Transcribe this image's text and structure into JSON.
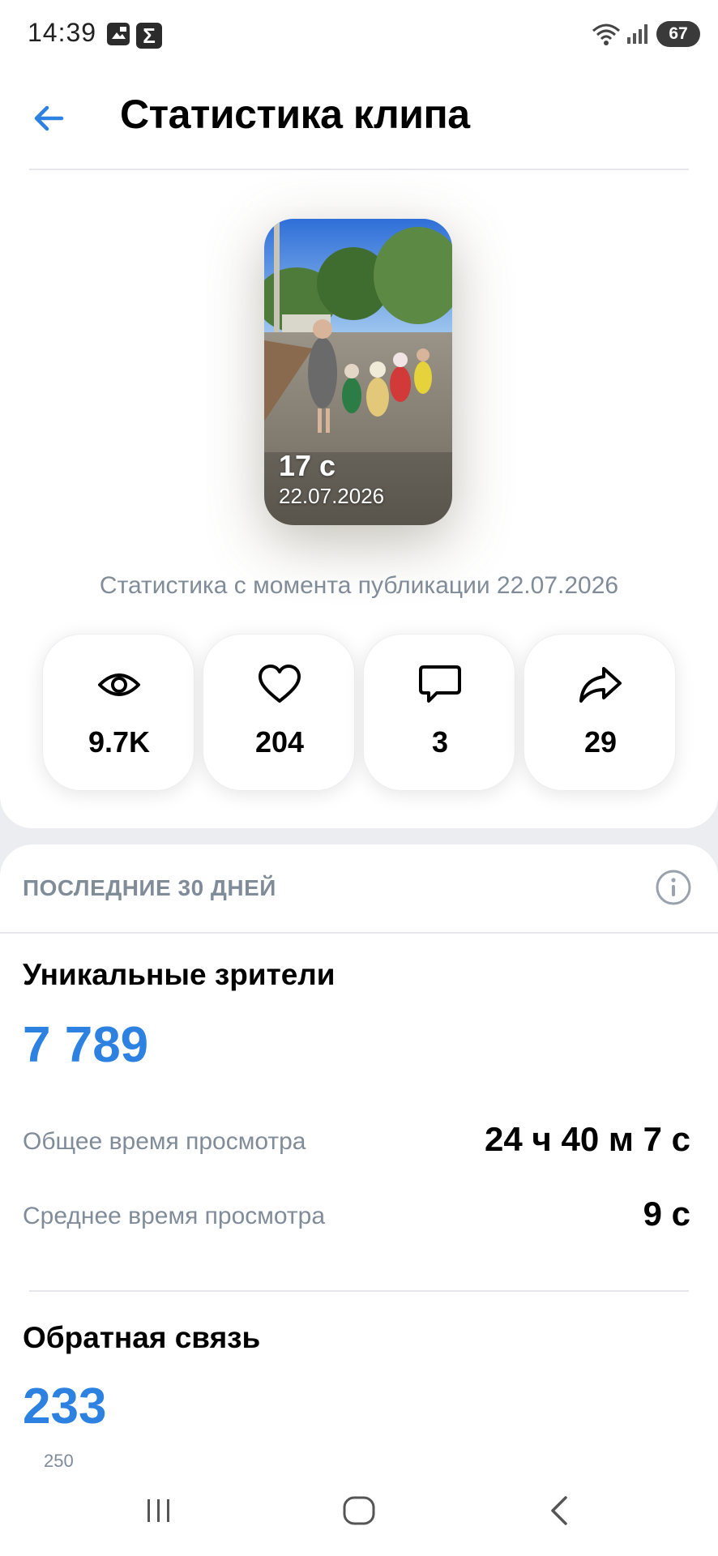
{
  "status_bar": {
    "time": "14:39",
    "notification_icons": [
      "media-icon",
      "sigma-app-icon"
    ],
    "sigma_glyph": "Σ",
    "battery": "67"
  },
  "header": {
    "title": "Статистика клипа",
    "back_icon": "arrow-left-icon"
  },
  "clip": {
    "duration": "17 с",
    "date": "22.07.2026"
  },
  "since_text": "Статистика с момента публикации 22.07.2026",
  "metrics": [
    {
      "icon": "eye-icon",
      "value": "9.7K"
    },
    {
      "icon": "heart-icon",
      "value": "204"
    },
    {
      "icon": "comment-icon",
      "value": "3"
    },
    {
      "icon": "share-icon",
      "value": "29"
    }
  ],
  "period": {
    "header": "ПОСЛЕДНИЕ 30 ДНЕЙ",
    "info_icon": "info-icon"
  },
  "unique_viewers": {
    "title": "Уникальные зрители",
    "value": "7 789"
  },
  "watch_time": {
    "total_label": "Общее время просмотра",
    "total_value": "24 ч 40 м 7 с",
    "avg_label": "Среднее время просмотра",
    "avg_value": "9 с"
  },
  "feedback": {
    "title": "Обратная связь",
    "value": "233",
    "cut_label": "250"
  },
  "colors": {
    "accent": "#2d81e0",
    "secondary_text": "#818c99",
    "background": "#ebedf0"
  },
  "nav_icons": [
    "recents-icon",
    "home-icon",
    "back-icon"
  ]
}
